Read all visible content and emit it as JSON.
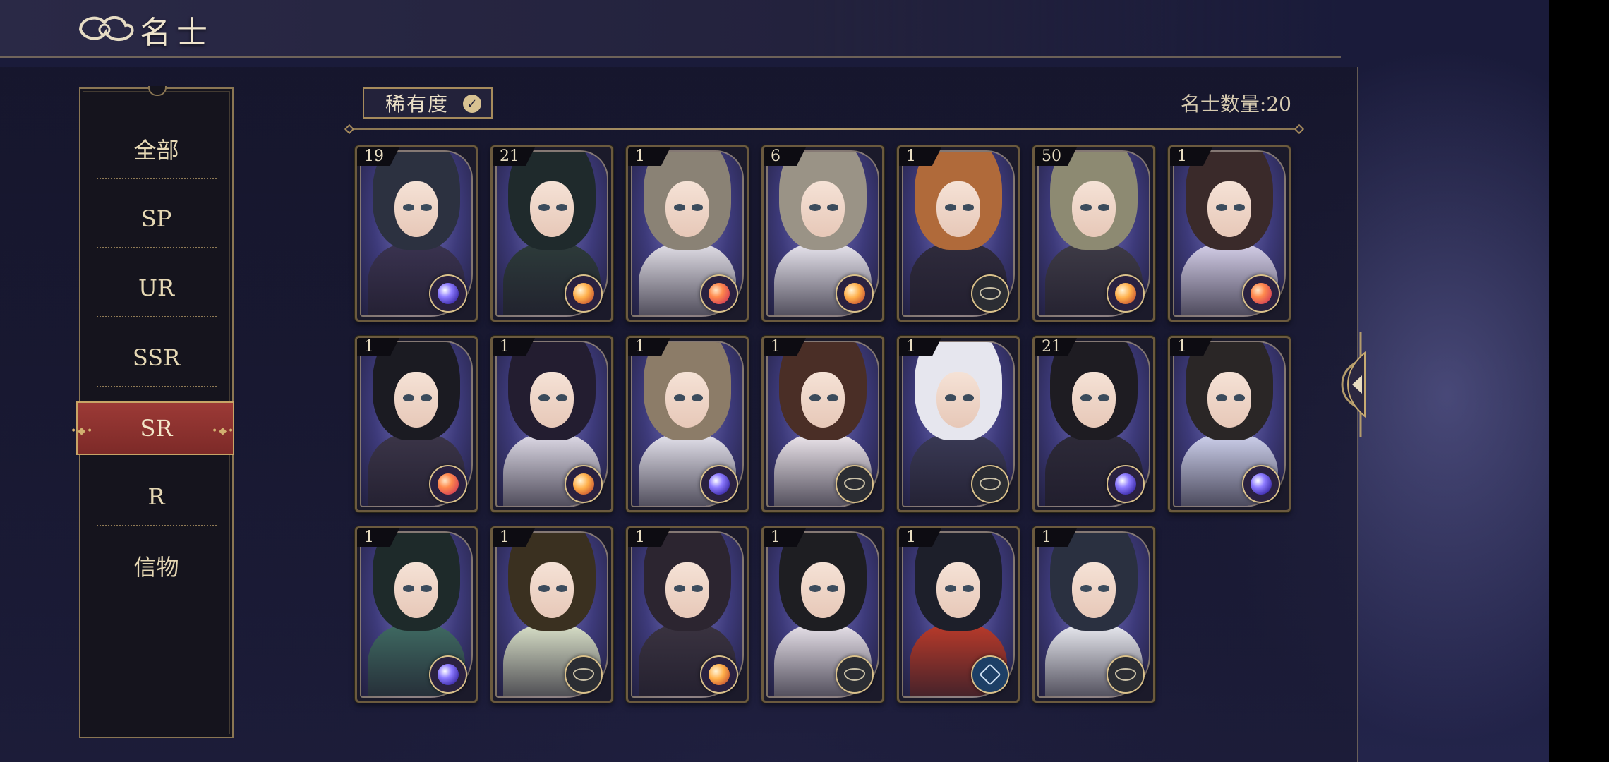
{
  "header": {
    "title": "名士"
  },
  "sidebar": {
    "items": [
      {
        "label": "全部"
      },
      {
        "label": "SP"
      },
      {
        "label": "UR"
      },
      {
        "label": "SSR"
      },
      {
        "label": "SR",
        "selected": true
      },
      {
        "label": "R"
      },
      {
        "label": "信物"
      }
    ]
  },
  "toolbar": {
    "filter_label": "稀有度",
    "count_label": "名士数量:",
    "count_value": "20"
  },
  "cards": [
    {
      "level": "19",
      "badge": "orb-purple",
      "hair": "#2c3140",
      "outfit": "#3a3350"
    },
    {
      "level": "21",
      "badge": "orb-orange",
      "hair": "#1f2a2c",
      "outfit": "#2d3b3a"
    },
    {
      "level": "1",
      "badge": "orb-red",
      "hair": "#8a8275",
      "outfit": "#e3e0e8"
    },
    {
      "level": "6",
      "badge": "orb-orange",
      "hair": "#9a9386",
      "outfit": "#e9e6ef"
    },
    {
      "level": "1",
      "badge": "dark",
      "hair": "#b06a3a",
      "outfit": "#2f2b3c"
    },
    {
      "level": "50",
      "badge": "orb-orange",
      "hair": "#8d8a72",
      "outfit": "#3e3b46"
    },
    {
      "level": "1",
      "badge": "orb-red",
      "hair": "#3a2a2a",
      "outfit": "#d6d0ea"
    },
    {
      "level": "1",
      "badge": "orb-red",
      "hair": "#1b1b22",
      "outfit": "#3b3548"
    },
    {
      "level": "1",
      "badge": "orb-orange",
      "hair": "#231d30",
      "outfit": "#e0dce8"
    },
    {
      "level": "1",
      "badge": "orb-purple",
      "hair": "#8c7c68",
      "outfit": "#e6e4ee"
    },
    {
      "level": "1",
      "badge": "dark",
      "hair": "#4a2e26",
      "outfit": "#efe8ee"
    },
    {
      "level": "1",
      "badge": "dark",
      "hair": "#e6e6ee",
      "outfit": "#3a3a55"
    },
    {
      "level": "21",
      "badge": "orb-purple",
      "hair": "#1e1c22",
      "outfit": "#2d2a38"
    },
    {
      "level": "1",
      "badge": "orb-purple",
      "hair": "#2a2626",
      "outfit": "#cfd2ee"
    },
    {
      "level": "1",
      "badge": "orb-purple",
      "hair": "#1e2a2a",
      "outfit": "#3f6a62"
    },
    {
      "level": "1",
      "badge": "dark",
      "hair": "#3a3020",
      "outfit": "#d9e0c8"
    },
    {
      "level": "1",
      "badge": "orb-orange",
      "hair": "#2c2530",
      "outfit": "#3a3340"
    },
    {
      "level": "1",
      "badge": "dark",
      "hair": "#1e1e22",
      "outfit": "#e8e2ea"
    },
    {
      "level": "1",
      "badge": "blue",
      "hair": "#1d1f2a",
      "outfit": "#b93a2a"
    },
    {
      "level": "1",
      "badge": "dark",
      "hair": "#2a3040",
      "outfit": "#e9eaf0"
    }
  ],
  "colors": {
    "selected_tab": "#8e3230",
    "gold_border": "#a68b5c",
    "panel": "#1c1c36"
  }
}
